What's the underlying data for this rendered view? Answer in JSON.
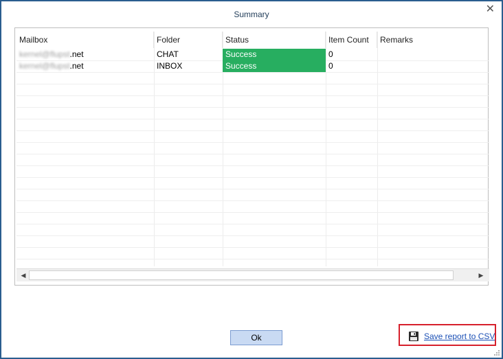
{
  "dialog": {
    "title": "Summary",
    "close_glyph": "✕"
  },
  "table": {
    "columns": [
      "Mailbox",
      "Folder",
      "Status",
      "Item Count",
      "Remarks"
    ],
    "rows": [
      {
        "mailbox_blurred": "kernel@flupst",
        "mailbox_suffix": ".net",
        "folder": "CHAT",
        "status": "Success",
        "item_count": "0",
        "remarks": ""
      },
      {
        "mailbox_blurred": "kernel@flupst",
        "mailbox_suffix": ".net",
        "folder": "INBOX",
        "status": "Success",
        "item_count": "0",
        "remarks": ""
      }
    ]
  },
  "scrollbar": {
    "left_arrow": "◀",
    "right_arrow": "▶"
  },
  "buttons": {
    "ok_label": "Ok"
  },
  "save_link": {
    "label": "Save report to CSV",
    "icon": "floppy-disk-icon"
  },
  "colors": {
    "success": "#27ae60",
    "highlight_border": "#d61f2b",
    "link": "#1a4fb5"
  }
}
